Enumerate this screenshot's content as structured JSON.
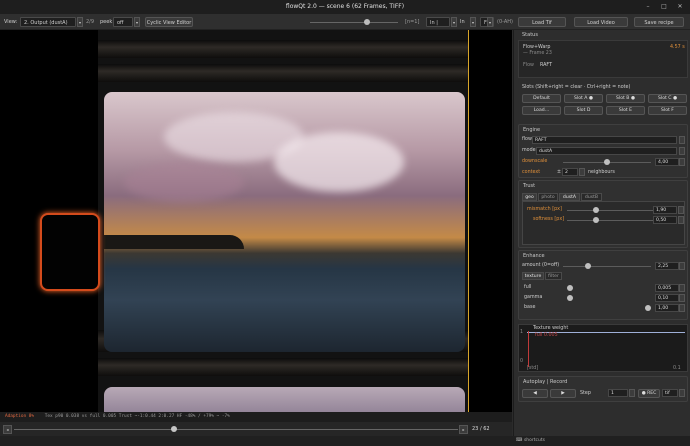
{
  "window": {
    "title": "flowQt 2.0 — scene 6  (62 Frames, TIFF)",
    "controls": [
      "–",
      "□",
      "✕"
    ]
  },
  "toolbar": {
    "view_label": "View:",
    "view_select": "2. Output (dustA)",
    "view_count": "2/9",
    "peek_label": "peek",
    "peek_value": "off",
    "cyclic_btn": "Cyclic View Editor",
    "zoom_readout": "[n=1]",
    "mode_in_view": "In | View",
    "in_label": "In",
    "fit_label": "Fit",
    "shortcut_hint": "(0-AH)",
    "load_tif": "Load Tif",
    "load_video": "Load Video",
    "save_recipe": "Save recipe"
  },
  "status_line": {
    "adaption": "Adaption 8%",
    "metrics": "Tex p90 0.038 vs full 0.005   Trust ~-1:0.44  2:0.27   HF -48% / +79% ~ -7%"
  },
  "scrubber": {
    "prev": "◂",
    "next": "▸",
    "position": 23,
    "total": 62,
    "counter": "23 / 62"
  },
  "footer": {
    "shortcuts": "shortcuts"
  },
  "panel": {
    "status": {
      "title": "Status",
      "mode": "Flow+Warp",
      "frame": "— Frame 23",
      "time": "4.57 s",
      "flow_label": "Flow",
      "flow_value": "RAFT"
    },
    "slots": {
      "title": "Slots  (Shift+right = clear · Ctrl+right = note)",
      "buttons": [
        "Default",
        "Slot A ●",
        "Slot B ●",
        "Slot C ●",
        "Load…",
        "Slot D",
        "Slot E",
        "Slot F"
      ]
    },
    "engine": {
      "title": "Engine",
      "flow_label": "flow",
      "flow_value": "RAFT",
      "mode_label": "mode",
      "mode_value": "dustA",
      "downscale_label": "downscale",
      "downscale_value": "4,00",
      "downscale_fraction": 0.5,
      "context_label": "context",
      "context_prefix": "±",
      "context_value": "2",
      "context_suffix": "neighbours"
    },
    "trust": {
      "title": "Trust",
      "tabs": [
        "geo",
        "photo",
        "dustA",
        "dustB"
      ],
      "mismatch_label": "mismatch [px]",
      "mismatch_value": "1,90",
      "mismatch_fraction": 0.33,
      "softness_label": "softness [px]",
      "softness_value": "0,50",
      "softness_fraction": 0.33
    },
    "enhance": {
      "title": "Enhance",
      "amount_label": "amount (0=off)",
      "amount_value": "2,25",
      "amount_fraction": 0.28,
      "tabs": [
        "texture",
        "filter"
      ],
      "full_label": "full",
      "full_value": "0,005",
      "gamma_label": "gamma",
      "gamma_value": "0,10",
      "base_label": "base",
      "base_value": "1,00"
    },
    "graph": {
      "title": "Texture weight",
      "marker": "full 0.005",
      "y_top": "1",
      "y_bottom": "0",
      "x_left": "[std]",
      "x_right": "0.1"
    },
    "autoplay": {
      "title": "Autoplay | Record",
      "prev": "◀",
      "next": "▶",
      "step_label": "Step",
      "step_value": "1",
      "rec": "● REC",
      "format": "tif"
    }
  },
  "colors": {
    "accent": "#e0903a",
    "adaption": "#e06840",
    "marker": "#d44b1c",
    "cursor": "#d8a52a"
  }
}
